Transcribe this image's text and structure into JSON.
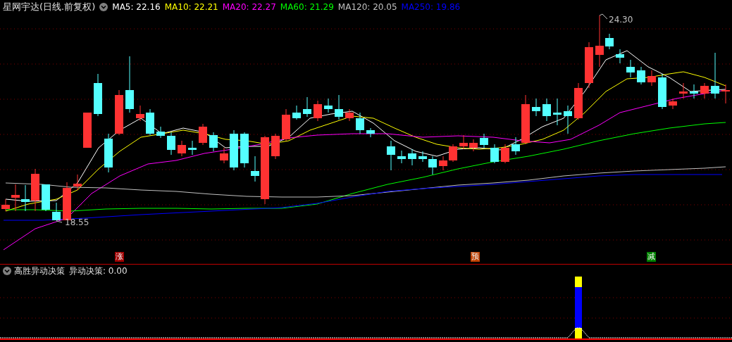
{
  "main_panel": {
    "title": "星网宇达(日线.前复权)",
    "moving_averages": [
      {
        "label": "MA5: 22.16",
        "color": "#ffffff"
      },
      {
        "label": "MA10: 22.21",
        "color": "#ffff00"
      },
      {
        "label": "MA20: 22.27",
        "color": "#ff00ff"
      },
      {
        "label": "MA60: 21.29",
        "color": "#00ff00"
      },
      {
        "label": "MA120: 20.05",
        "color": "#c0c0c0"
      },
      {
        "label": "MA250: 19.86",
        "color": "#0000ff"
      }
    ],
    "high_label": "24.30",
    "low_label": "18.55",
    "signals": [
      {
        "text": "涨",
        "color": "#a00000"
      },
      {
        "text": "预",
        "color": "#c04000"
      },
      {
        "text": "减",
        "color": "#008000"
      }
    ]
  },
  "indicator_panel": {
    "title": "高胜异动决策",
    "reading": "异动决策: 0.00"
  }
}
